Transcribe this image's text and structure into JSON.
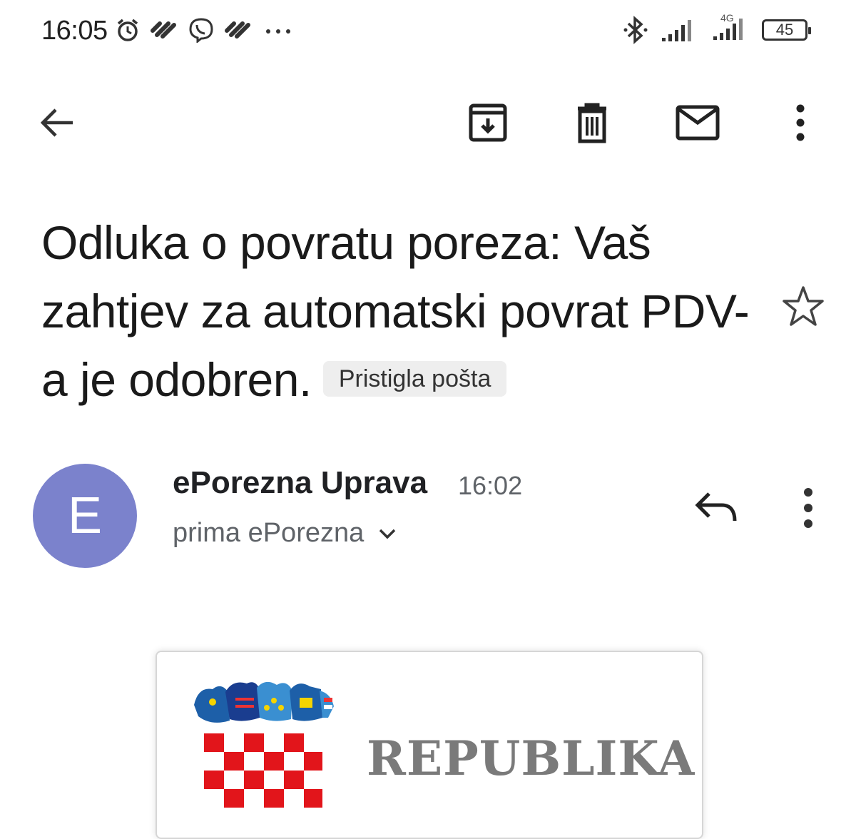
{
  "status_bar": {
    "time": "16:05",
    "left_icons": [
      "alarm-icon",
      "notification-icon",
      "viber-icon",
      "notification-icon",
      "more-dots-icon"
    ],
    "right_icons": [
      "bluetooth-icon",
      "signal-icon",
      "signal-4g-icon",
      "battery-icon"
    ],
    "network_label": "4G",
    "battery_level": "45"
  },
  "toolbar": {
    "back_icon": "arrow-back-icon",
    "actions": [
      "archive-icon",
      "delete-icon",
      "mark-unread-icon",
      "more-vert-icon"
    ]
  },
  "email": {
    "subject": "Odluka o povratu poreza: Vaš zahtjev za automatski povrat PDV-a je odobren.",
    "label": "Pristigla pošta",
    "starred": false
  },
  "sender": {
    "avatar_letter": "E",
    "avatar_color": "#7b82cc",
    "name": "ePorezna Uprava",
    "time": "16:02",
    "recipient": "prima ePorezna"
  },
  "body": {
    "heading_text": "REPUBLIKA"
  }
}
